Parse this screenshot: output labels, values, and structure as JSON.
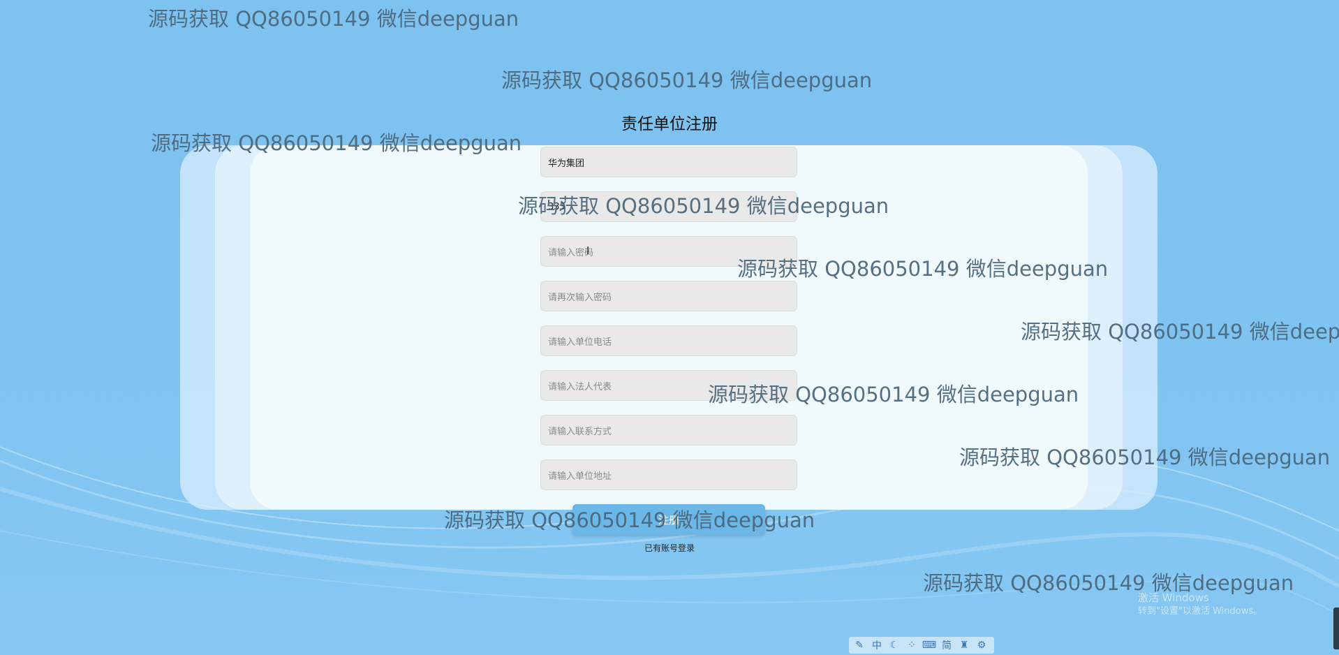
{
  "form": {
    "title": "责任单位注册",
    "fields": [
      {
        "name": "unit-name",
        "value": "华为集团",
        "placeholder": ""
      },
      {
        "name": "account",
        "value": "333",
        "placeholder": ""
      },
      {
        "name": "password",
        "value": "",
        "placeholder": "请输入密码"
      },
      {
        "name": "confirm-password",
        "value": "",
        "placeholder": "请再次输入密码"
      },
      {
        "name": "unit-phone",
        "value": "",
        "placeholder": "请输入单位电话"
      },
      {
        "name": "legal-rep",
        "value": "",
        "placeholder": "请输入法人代表"
      },
      {
        "name": "contact",
        "value": "",
        "placeholder": "请输入联系方式"
      },
      {
        "name": "unit-address",
        "value": "",
        "placeholder": "请输入单位地址"
      }
    ],
    "submit_label": "注册",
    "login_link": "已有账号登录"
  },
  "watermark_text": "源码获取 QQ86050149 微信deepguan",
  "watermarks": [
    {
      "text": "源码获取 QQ86050149 微信deepguan"
    },
    {
      "text": "源码获取 QQ86050149 微信deepguan"
    },
    {
      "text": "源码获取 QQ86050149 微信deepguan"
    },
    {
      "text": "源码获取 QQ86050149 微信deepguan"
    },
    {
      "text": "源码获取 QQ86050149 微信deepguan"
    },
    {
      "text": "源码获取 QQ86050149 微信deep"
    },
    {
      "text": "源码获取 QQ86050149 微信deepguan"
    },
    {
      "text": "源码获取 QQ86050149 微信deepguan"
    },
    {
      "text": "源码获取 QQ86050149 微信deepguan"
    },
    {
      "text": "源码获取 QQ86050149 微信deepguan"
    }
  ],
  "system": {
    "activate_title": "激活 Windows",
    "activate_sub": "转到\"设置\"以激活 Windows。",
    "ime_items": [
      "中",
      "简"
    ],
    "ime_icons": [
      "ime-logo-icon",
      "moon-icon",
      "dots-icon",
      "keyboard-icon",
      "shirt-icon",
      "gear-icon"
    ]
  },
  "colors": {
    "background": "#7ec2ef",
    "button": "#6ab7e8",
    "watermark": "#4a6579"
  }
}
